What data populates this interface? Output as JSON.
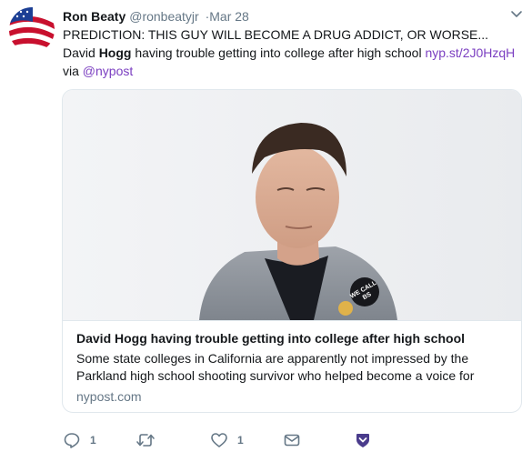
{
  "tweet": {
    "author_name": "Ron Beaty",
    "handle": "@ronbeatyjr",
    "separator": "·",
    "date": "Mar 28",
    "text_part1": "PREDICTION: THIS GUY WILL BECOME A DRUG ADDICT, OR WORSE... David ",
    "text_bold": "Hogg",
    "text_part2": " having trouble getting into college after high school ",
    "text_link": "nyp.st/2J0HzqH",
    "text_part3": " via ",
    "text_mention": "@nypost"
  },
  "card": {
    "image_badge_text": "WE CALL BS",
    "title": "David Hogg having trouble getting into college after high school",
    "description": "Some state colleges in California are apparently not impressed by the Parkland high school shooting survivor who helped become a voice for",
    "domain": "nypost.com"
  },
  "actions": {
    "reply_count": "1",
    "retweet_count": "",
    "like_count": "1"
  },
  "icons": {
    "reply": "reply-icon",
    "retweet": "retweet-icon",
    "like": "heart-icon",
    "message": "envelope-icon",
    "verified_share": "shield-icon"
  },
  "colors": {
    "link": "#7b3fc1",
    "muted": "#657786",
    "share_icon": "#4a3c8c"
  }
}
